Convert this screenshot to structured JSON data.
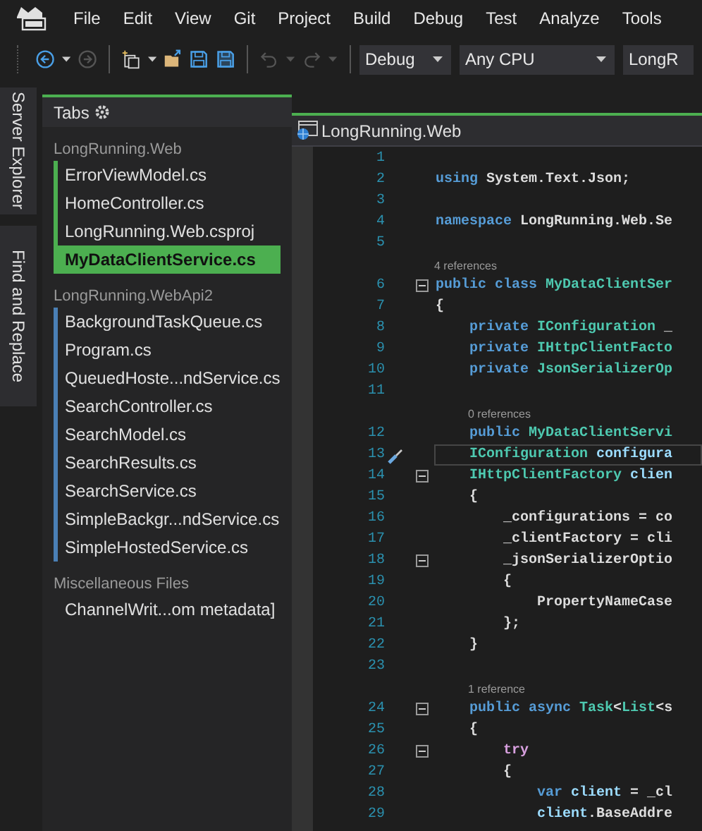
{
  "menu": [
    "File",
    "Edit",
    "View",
    "Git",
    "Project",
    "Build",
    "Debug",
    "Test",
    "Analyze",
    "Tools"
  ],
  "toolbar": {
    "items": [
      {
        "kind": "back",
        "disabled": false,
        "menu": true
      },
      {
        "kind": "forward",
        "disabled": true,
        "menu": false
      },
      {
        "kind": "separator"
      },
      {
        "kind": "new-item",
        "disabled": false,
        "menu": true
      },
      {
        "kind": "open",
        "disabled": false,
        "menu": false
      },
      {
        "kind": "save",
        "disabled": false,
        "menu": false
      },
      {
        "kind": "save-all",
        "disabled": false,
        "menu": false
      },
      {
        "kind": "separator"
      },
      {
        "kind": "undo",
        "disabled": true,
        "menu": true
      },
      {
        "kind": "redo",
        "disabled": true,
        "menu": true
      },
      {
        "kind": "separator"
      }
    ],
    "dropdowns": [
      {
        "value": "Debug"
      },
      {
        "value": "Any CPU"
      },
      {
        "value": "LongR"
      }
    ]
  },
  "side_tabs": [
    "Server Explorer",
    "Find and Replace"
  ],
  "tabs_panel": {
    "title": "Tabs",
    "groups": [
      {
        "name": "LongRunning.Web",
        "color": "#4caf50",
        "items": [
          {
            "label": "ErrorViewModel.cs",
            "selected": false
          },
          {
            "label": "HomeController.cs",
            "selected": false
          },
          {
            "label": "LongRunning.Web.csproj",
            "selected": false
          },
          {
            "label": "MyDataClientService.cs",
            "selected": true
          }
        ]
      },
      {
        "name": "LongRunning.WebApi2",
        "color": "#4a7fb5",
        "items": [
          {
            "label": "BackgroundTaskQueue.cs",
            "selected": false
          },
          {
            "label": "Program.cs",
            "selected": false
          },
          {
            "label": "QueuedHoste...ndService.cs",
            "selected": false
          },
          {
            "label": "SearchController.cs",
            "selected": false
          },
          {
            "label": "SearchModel.cs",
            "selected": false
          },
          {
            "label": "SearchResults.cs",
            "selected": false
          },
          {
            "label": "SearchService.cs",
            "selected": false
          },
          {
            "label": "SimpleBackgr...ndService.cs",
            "selected": false
          },
          {
            "label": "SimpleHostedService.cs",
            "selected": false
          }
        ]
      },
      {
        "name": "Miscellaneous Files",
        "items": [
          {
            "label": "ChannelWrit...om metadata]",
            "selected": false
          }
        ]
      }
    ]
  },
  "editor": {
    "tab": "LongRunning.Web",
    "lines": [
      {
        "number": "1",
        "fold": false,
        "current": false
      },
      {
        "number": "2",
        "fold": false,
        "current": false,
        "tokens": [
          {
            "text": "using",
            "kind": "keyword"
          },
          {
            "text": " System.Text.Json;",
            "kind": "plain"
          }
        ]
      },
      {
        "number": "3",
        "fold": false,
        "current": false
      },
      {
        "number": "4",
        "fold": false,
        "current": false,
        "tokens": [
          {
            "text": "namespace",
            "kind": "keyword"
          },
          {
            "text": " LongRunning.Web.Se",
            "kind": "plain"
          }
        ]
      },
      {
        "number": "5",
        "fold": false,
        "current": false
      },
      {
        "number": "6",
        "fold": true,
        "current": false,
        "lens": "4 references",
        "tokens": [
          {
            "text": "public class",
            "kind": "keyword"
          },
          {
            "text": " MyDataClientSer",
            "kind": "type"
          }
        ]
      },
      {
        "number": "7",
        "fold": false,
        "current": false,
        "tokens": [
          {
            "text": "{",
            "kind": "plain"
          }
        ]
      },
      {
        "number": "8",
        "fold": false,
        "current": false,
        "tokens": [
          {
            "text": "    private",
            "kind": "keyword"
          },
          {
            "text": " IConfiguration",
            "kind": "type"
          },
          {
            "text": " _",
            "kind": "plain"
          }
        ]
      },
      {
        "number": "9",
        "fold": false,
        "current": false,
        "tokens": [
          {
            "text": "    private",
            "kind": "keyword"
          },
          {
            "text": " IHttpClientFacto",
            "kind": "type"
          }
        ]
      },
      {
        "number": "10",
        "fold": false,
        "current": false,
        "tokens": [
          {
            "text": "    private",
            "kind": "keyword"
          },
          {
            "text": " JsonSerializerOp",
            "kind": "type"
          }
        ]
      },
      {
        "number": "11",
        "fold": false,
        "current": false
      },
      {
        "number": "12",
        "fold": false,
        "current": false,
        "lens": "0 references",
        "tokens": [
          {
            "text": "    public",
            "kind": "keyword"
          },
          {
            "text": " MyDataClientServi",
            "kind": "type"
          }
        ]
      },
      {
        "number": "13",
        "fold": false,
        "current": true,
        "tokens": [
          {
            "text": "    IConfiguration",
            "kind": "type"
          },
          {
            "text": " configura",
            "kind": "variable"
          }
        ]
      },
      {
        "number": "14",
        "fold": true,
        "current": false,
        "tokens": [
          {
            "text": "    IHttpClientFactory",
            "kind": "type"
          },
          {
            "text": " clien",
            "kind": "variable"
          }
        ]
      },
      {
        "number": "15",
        "fold": false,
        "current": false,
        "tokens": [
          {
            "text": "    {",
            "kind": "plain"
          }
        ]
      },
      {
        "number": "16",
        "fold": false,
        "current": false,
        "tokens": [
          {
            "text": "        _configurations = co",
            "kind": "plain"
          }
        ]
      },
      {
        "number": "17",
        "fold": false,
        "current": false,
        "tokens": [
          {
            "text": "        _clientFactory = cli",
            "kind": "plain"
          }
        ]
      },
      {
        "number": "18",
        "fold": true,
        "current": false,
        "tokens": [
          {
            "text": "        _jsonSerializerOptio",
            "kind": "plain"
          }
        ]
      },
      {
        "number": "19",
        "fold": false,
        "current": false,
        "tokens": [
          {
            "text": "        {",
            "kind": "plain"
          }
        ]
      },
      {
        "number": "20",
        "fold": false,
        "current": false,
        "tokens": [
          {
            "text": "            PropertyNameCase",
            "kind": "plain"
          }
        ]
      },
      {
        "number": "21",
        "fold": false,
        "current": false,
        "tokens": [
          {
            "text": "        };",
            "kind": "plain"
          }
        ]
      },
      {
        "number": "22",
        "fold": false,
        "current": false,
        "tokens": [
          {
            "text": "    }",
            "kind": "plain"
          }
        ]
      },
      {
        "number": "23",
        "fold": false,
        "current": false
      },
      {
        "number": "24",
        "fold": true,
        "current": false,
        "lens": "1 reference",
        "tokens": [
          {
            "text": "    public async",
            "kind": "keyword"
          },
          {
            "text": " Task",
            "kind": "type"
          },
          {
            "text": "<",
            "kind": "plain"
          },
          {
            "text": "List",
            "kind": "type"
          },
          {
            "text": "<s",
            "kind": "plain"
          }
        ]
      },
      {
        "number": "25",
        "fold": false,
        "current": false,
        "tokens": [
          {
            "text": "    {",
            "kind": "plain"
          }
        ]
      },
      {
        "number": "26",
        "fold": true,
        "current": false,
        "tokens": [
          {
            "text": "        try",
            "kind": "control"
          }
        ]
      },
      {
        "number": "27",
        "fold": false,
        "current": false,
        "tokens": [
          {
            "text": "        {",
            "kind": "plain"
          }
        ]
      },
      {
        "number": "28",
        "fold": false,
        "current": false,
        "tokens": [
          {
            "text": "            var",
            "kind": "keyword"
          },
          {
            "text": " client",
            "kind": "variable"
          },
          {
            "text": " = _cl",
            "kind": "plain"
          }
        ]
      },
      {
        "number": "29",
        "fold": false,
        "current": false,
        "tokens": [
          {
            "text": "            client",
            "kind": "variable"
          },
          {
            "text": ".BaseAddre",
            "kind": "plain"
          }
        ]
      }
    ]
  }
}
